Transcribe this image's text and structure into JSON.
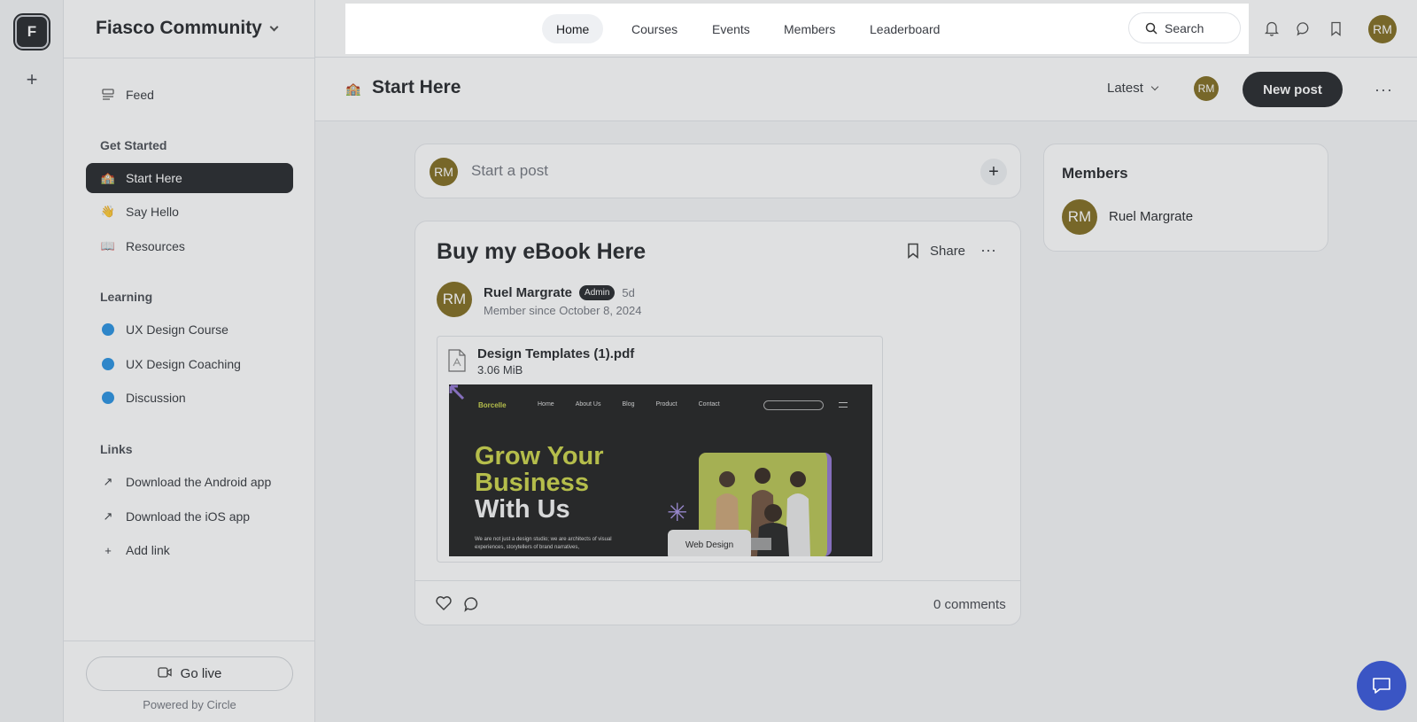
{
  "rail": {
    "logo_letter": "F",
    "add_icon": "plus-icon"
  },
  "community": {
    "name": "Fiasco Community"
  },
  "sidebar": {
    "feed": "Feed",
    "sections": [
      {
        "label": "Get Started",
        "items": [
          {
            "label": "Start Here",
            "icon": "🏫"
          },
          {
            "label": "Say Hello",
            "icon": "👋"
          },
          {
            "label": "Resources",
            "icon": "📖"
          }
        ]
      },
      {
        "label": "Learning",
        "items": [
          {
            "label": "UX Design Course"
          },
          {
            "label": "UX Design Coaching"
          },
          {
            "label": "Discussion"
          }
        ]
      },
      {
        "label": "Links",
        "items": [
          {
            "label": "Download the Android app"
          },
          {
            "label": "Download the iOS app"
          },
          {
            "label": "Add link"
          }
        ]
      }
    ],
    "go_live": "Go live",
    "powered_by": "Powered by Circle"
  },
  "topnav": {
    "tabs": [
      "Home",
      "Courses",
      "Events",
      "Members",
      "Leaderboard"
    ],
    "active_tab": "Home",
    "search_placeholder": "Search",
    "avatar_initials": "RM"
  },
  "page": {
    "emoji": "🏫",
    "title": "Start Here",
    "sort": "Latest",
    "avatar_initials": "RM",
    "new_post": "New post"
  },
  "composer": {
    "avatar_initials": "RM",
    "placeholder": "Start a post"
  },
  "post": {
    "title": "Buy my eBook Here",
    "share": "Share",
    "author": "Ruel Margrate",
    "author_initials": "RM",
    "badge": "Admin",
    "time": "5d",
    "member_since": "Member since October 8, 2024",
    "attachment": {
      "name": "Design Templates (1).pdf",
      "size": "3.06 MiB"
    },
    "preview": {
      "logo": "Borcelle",
      "nav": [
        "Home",
        "About Us",
        "Blog",
        "Product",
        "Contact"
      ],
      "headline_1": "Grow Your",
      "headline_2": "Business",
      "headline_3": "With Us",
      "body": "We are not just a design studio; we are architects of visual experiences, storytellers of brand narratives,",
      "tag": "Web Design"
    },
    "comments": "0 comments"
  },
  "members_widget": {
    "title": "Members",
    "members": [
      {
        "name": "Ruel Margrate",
        "initials": "RM"
      }
    ]
  },
  "colors": {
    "accent": "#191b1f",
    "avatar": "#7a6414",
    "chat": "#3a55c4",
    "channel_dot": "#1d8ce0"
  }
}
